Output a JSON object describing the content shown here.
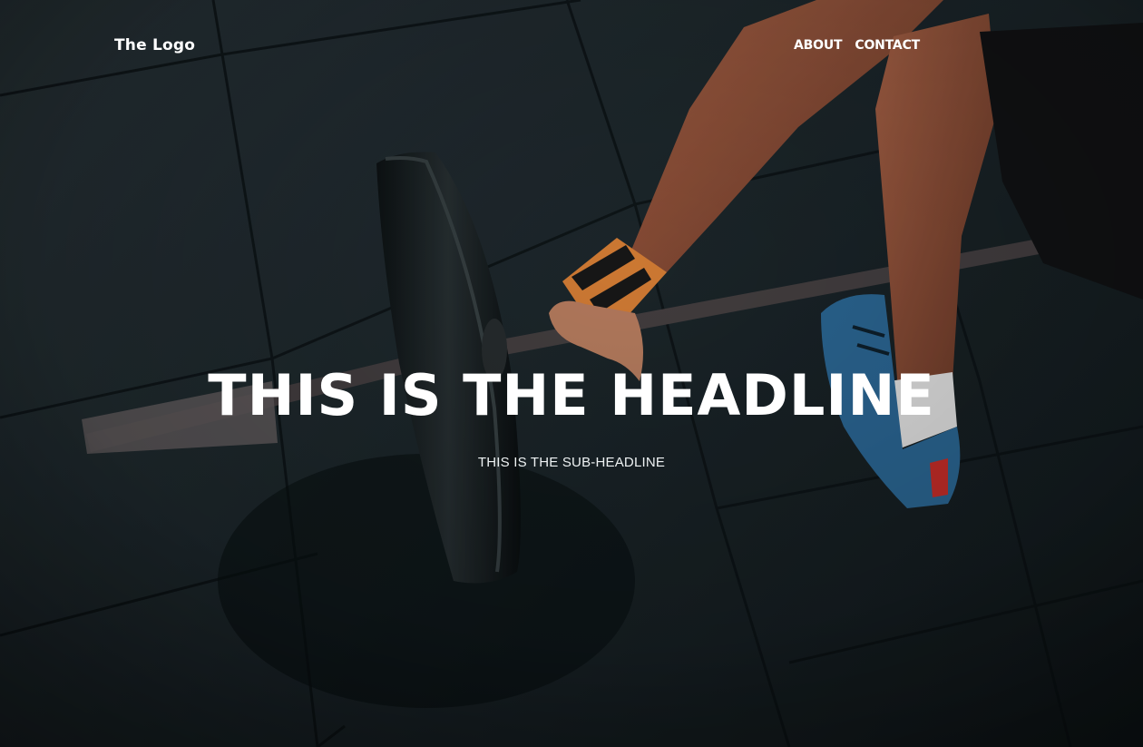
{
  "nav": {
    "logo": "The Logo",
    "links": [
      "ABOUT",
      "CONTACT"
    ]
  },
  "hero": {
    "headline": "THIS IS THE HEADLINE",
    "subheadline": "THIS IS THE SUB-HEADLINE",
    "background_image": "gym-floor-barbell-photo"
  }
}
